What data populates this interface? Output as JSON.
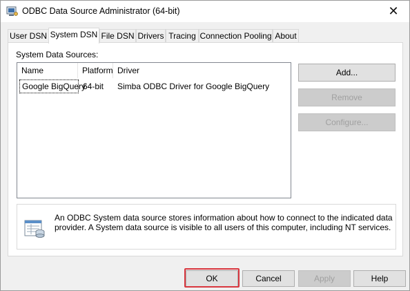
{
  "window": {
    "title": "ODBC Data Source Administrator (64-bit)",
    "close_glyph": "✕"
  },
  "tabs": [
    {
      "label": "User DSN"
    },
    {
      "label": "System DSN"
    },
    {
      "label": "File DSN"
    },
    {
      "label": "Drivers"
    },
    {
      "label": "Tracing"
    },
    {
      "label": "Connection Pooling"
    },
    {
      "label": "About"
    }
  ],
  "active_tab": "System DSN",
  "panel": {
    "group_label": "System Data Sources:",
    "columns": [
      "Name",
      "Platform",
      "Driver"
    ],
    "rows": [
      {
        "name": "Google BigQuery",
        "platform": "64-bit",
        "driver": "Simba ODBC Driver for Google BigQuery"
      }
    ],
    "buttons": {
      "add": "Add...",
      "remove": "Remove",
      "configure": "Configure..."
    },
    "info_text": "An ODBC System data source stores information about how to connect to the indicated data provider. A System data source is visible to all users of this computer, including NT services."
  },
  "footer": {
    "ok": "OK",
    "cancel": "Cancel",
    "apply": "Apply",
    "help": "Help"
  },
  "colors": {
    "highlight_ring": "#d9363e"
  }
}
